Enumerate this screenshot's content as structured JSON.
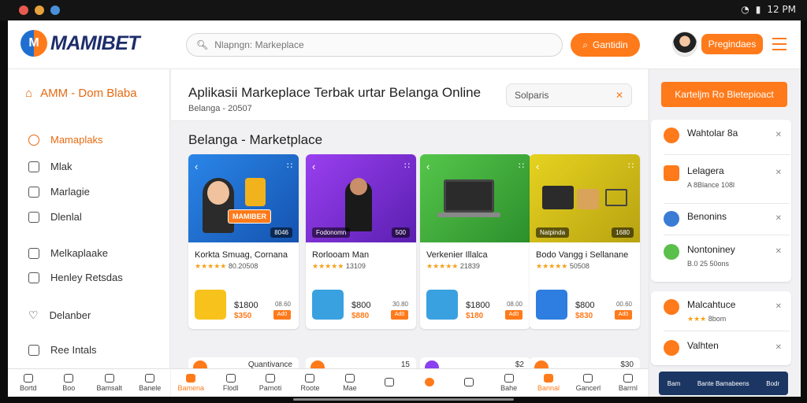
{
  "statusbar": {
    "right_text": "12 PM",
    "dots": [
      "#e85a4f",
      "#e8a13b",
      "#4a90d9"
    ]
  },
  "header": {
    "logo": "MAMIBET",
    "search_placeholder": "Nlapngn: Markeplace",
    "search_button": "Gantidin",
    "profile_button": "Pregindaes"
  },
  "sidebar": {
    "title": "AMM - Dom Blaba",
    "items": [
      {
        "label": "Mamaplaks"
      },
      {
        "label": "Mlak"
      },
      {
        "label": "Marlagie"
      },
      {
        "label": "Dlenlal"
      },
      {
        "label": "Melkaplaake"
      },
      {
        "label": "Henley Retsdas"
      },
      {
        "label": "Delanber"
      },
      {
        "label": "Ree Intals"
      }
    ]
  },
  "left_nav": [
    "Bortd",
    "Boo",
    "Bamsalt",
    "Banele"
  ],
  "main": {
    "title": "Aplikasii Markeplace Terbak urtar Belanga Online",
    "subtitle": "Belanga - 20507",
    "filter_text": "Solparis",
    "section_title": "Belanga - Marketplace",
    "cards": [
      {
        "tag": "8046",
        "badge": "MAMIBER",
        "name": "Korkta Smuag, Cornana",
        "rating": "★★★★★",
        "meta": "80.20508",
        "price": "$1800",
        "price2": "$350",
        "mini": "08.60",
        "cart": "Ad0",
        "accent": "#1f6fd1",
        "thumb": "#f7c21b"
      },
      {
        "tag": "500",
        "tag_left": "Fodonomn",
        "name": "Rorlooam Man",
        "rating": "★★★★★",
        "meta": "13109",
        "price": "$800",
        "price2": "$880",
        "mini": "30.80",
        "cart": "Ad0",
        "accent": "#7a2fd1",
        "thumb": "#3aa1e0"
      },
      {
        "tag": "",
        "name": "Verkenier Illalca",
        "rating": "★★★★★",
        "meta": "21839",
        "price": "$1800",
        "price2": "$180",
        "mini": "08.00",
        "cart": "Ad0",
        "accent": "#3fb53f",
        "thumb": "#3aa1e0"
      },
      {
        "tag": "1680",
        "tag_left": "Natpinda",
        "name": "Bodo Vangg i Sellanane",
        "rating": "★★★★★",
        "meta": "50508",
        "price": "$800",
        "price2": "$830",
        "mini": "00.60",
        "cart": "Ad0",
        "accent": "#d8c51a",
        "thumb": "#2e7de0"
      }
    ],
    "cards_row2": [
      "Quantivance",
      "15",
      "$2",
      "$30"
    ]
  },
  "main_nav": [
    "Bamena",
    "Flodl",
    "Parnoti",
    "Roote",
    "Mae",
    "",
    "",
    "",
    "Bahe",
    "Bannal",
    "Gancerl",
    "Barrnl"
  ],
  "right": {
    "cta": "Karteljm Ro Bletepioact",
    "items": [
      {
        "title": "Wahtolar 8a",
        "sub": ""
      },
      {
        "title": "Lelagera",
        "sub": "A 8Blance 108l"
      },
      {
        "title": "Benonins",
        "sub": ""
      },
      {
        "title": "Nontoniney",
        "sub": "B.0 25 50ons"
      }
    ],
    "items2": [
      {
        "title": "Malcahtuce",
        "sub": "8bom",
        "rating": "★★★"
      },
      {
        "title": "Valhten",
        "sub": ""
      }
    ],
    "bottom": [
      "Bam",
      "Bante Bamabeens",
      "Bodr"
    ]
  }
}
